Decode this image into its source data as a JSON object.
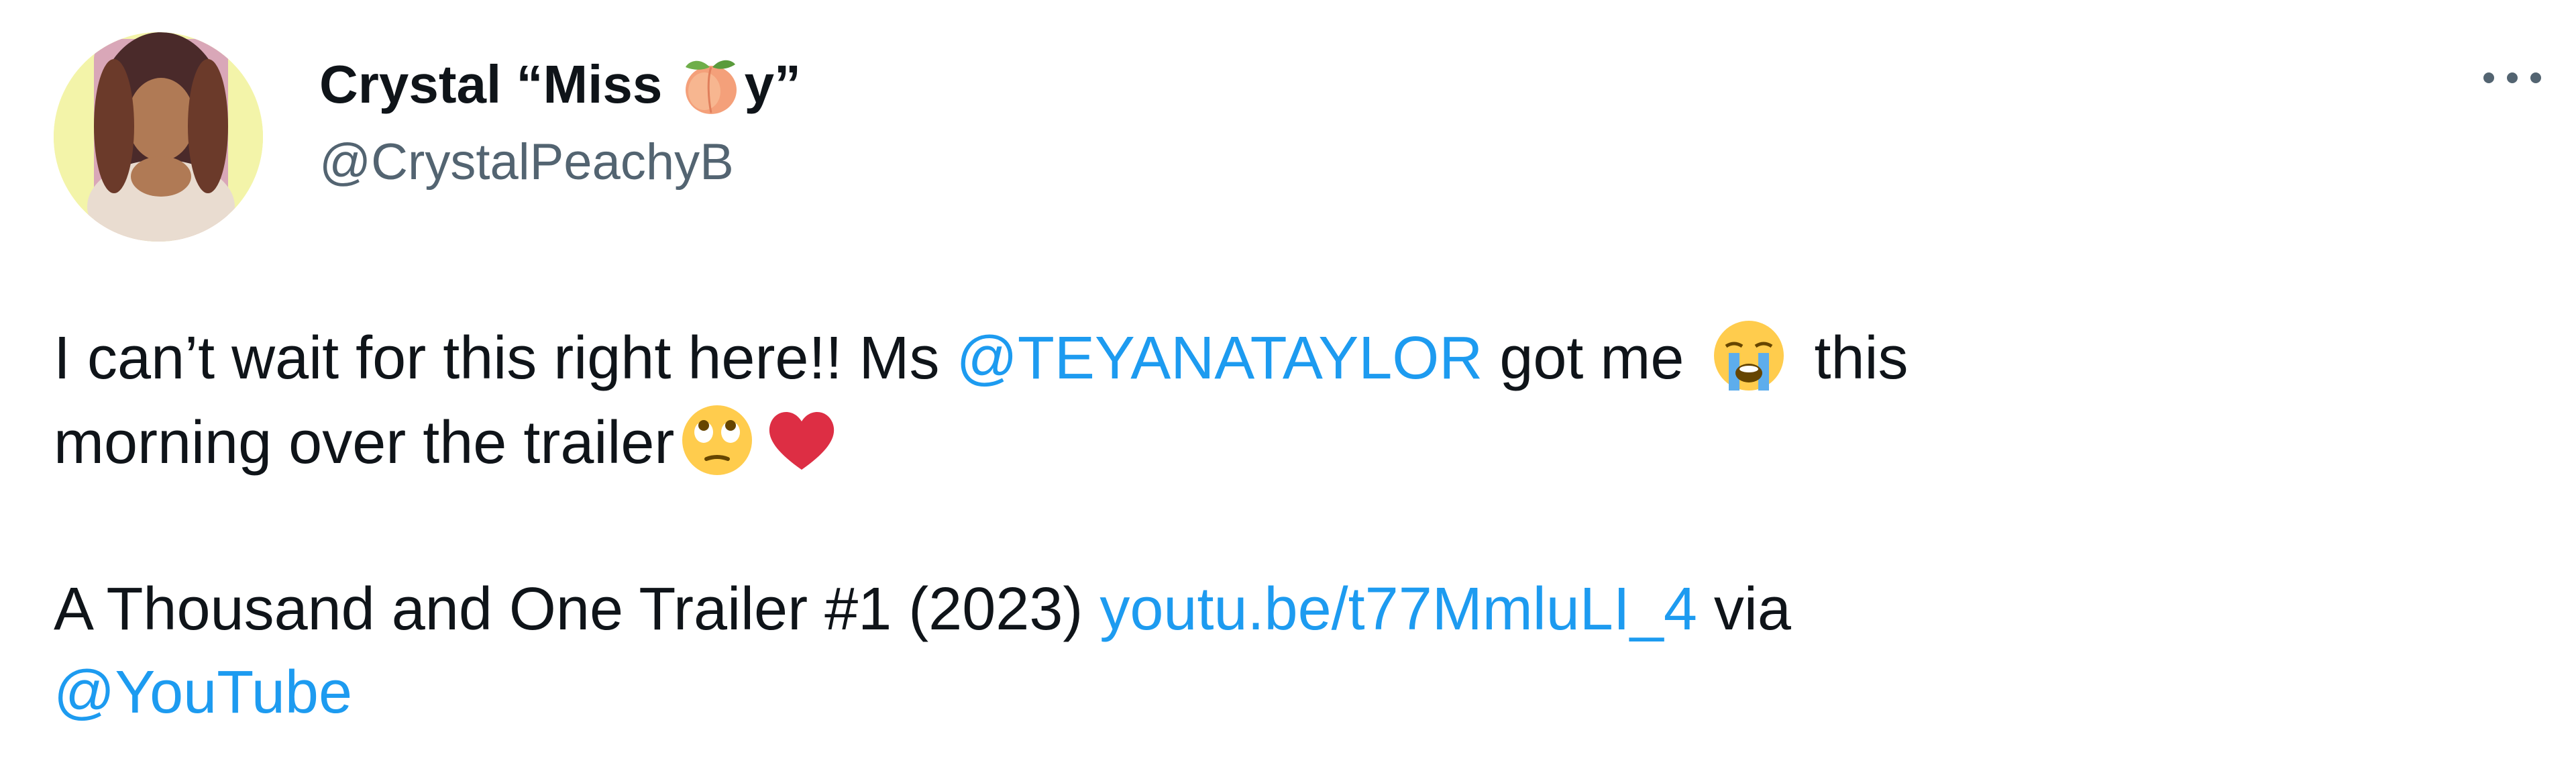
{
  "tweet": {
    "author": {
      "name_prefix": "Crystal “Miss ",
      "name_emoji": "peach",
      "name_suffix": "y”",
      "handle": "@CrystalPeachyB"
    },
    "more_options_icon": "ellipsis-icon",
    "text": {
      "line1_part1": "I can’t wait for this right here!! Ms ",
      "mention_teyana": "@TEYANATAYLOR",
      "line1_part2": " got me ",
      "emoji_crying": "loudly-crying-face",
      "line1_part3": " this",
      "line2_text": "morning over the trailer",
      "emoji_eyes": "face-with-rolling-eyes",
      "emoji_heart": "red-heart",
      "line3_text": "A Thousand and One Trailer #1 (2023) ",
      "link_url": "youtu.be/t77MmluLI_4",
      "line3_via": " via",
      "mention_youtube": "@YouTube"
    },
    "colors": {
      "link": "#1d9bf0",
      "handle": "#536471",
      "text": "#0f1419",
      "avatar_bg": "#f3f4a9"
    }
  }
}
